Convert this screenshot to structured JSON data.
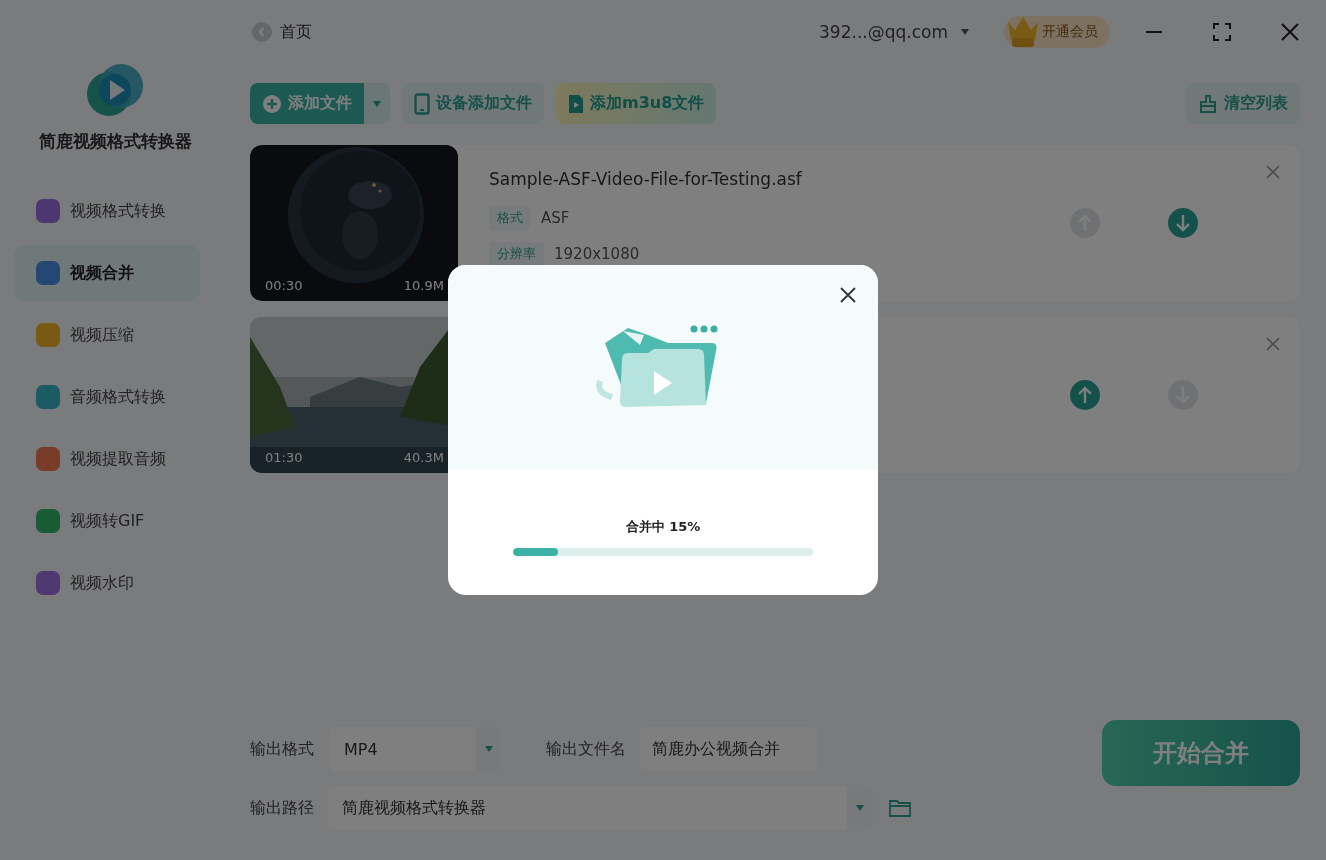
{
  "app": {
    "name": "简鹿视频格式转换器"
  },
  "sidebar": {
    "items": [
      {
        "label": "视频格式转换",
        "selected": false
      },
      {
        "label": "视频合并",
        "selected": true
      },
      {
        "label": "视频压缩",
        "selected": false
      },
      {
        "label": "音频格式转换",
        "selected": false
      },
      {
        "label": "视频提取音频",
        "selected": false
      },
      {
        "label": "视频转GIF",
        "selected": false
      },
      {
        "label": "视频水印",
        "selected": false
      }
    ]
  },
  "topbar": {
    "home": "首页",
    "account": "392...@qq.com",
    "vip_button": "开通会员"
  },
  "toolbar": {
    "buttons": [
      {
        "label": "添加文件",
        "kind": "primary"
      },
      {
        "label": "设备添加文件",
        "kind": "device"
      },
      {
        "label": "添加m3u8文件",
        "kind": "m3u8"
      }
    ],
    "clear_button": "清空列表"
  },
  "files": [
    {
      "name": "Sample-ASF-Video-File-for-Testing.asf",
      "duration": "00:30",
      "size": "10.9M",
      "meta": [
        {
          "label": "格式",
          "value": "ASF"
        },
        {
          "label": "分辨率",
          "value": "1920x1080"
        }
      ],
      "can_move_up": false,
      "can_move_down": true
    },
    {
      "duration": "01:30",
      "size": "40.3M",
      "can_move_up": true,
      "can_move_down": false
    }
  ],
  "output": {
    "format_label": "输出格式",
    "format": "MP4",
    "filename_label": "输出文件名",
    "filename": "简鹿办公视频合并",
    "path_label": "输出路径",
    "path": "简鹿视频格式转换器",
    "start_button": "开始合并"
  },
  "dialog": {
    "status": "合并中 15%",
    "level": 0.15
  }
}
